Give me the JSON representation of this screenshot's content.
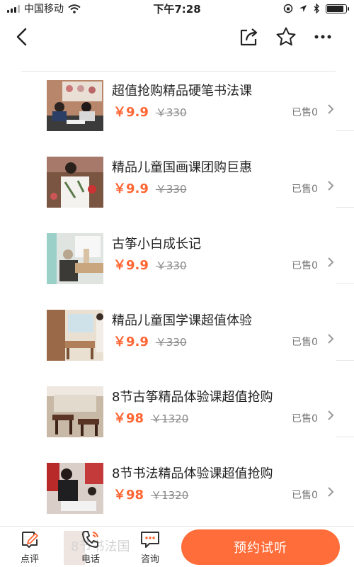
{
  "status_bar": {
    "carrier": "中国移动",
    "time": "下午7:28",
    "battery_level": 0.9
  },
  "items": [
    {
      "title": "超值抢购精品硬笔书法课",
      "price": "￥9.9",
      "original_price": "￥330",
      "sold": "已售0",
      "image": "calligraphy-class-photo"
    },
    {
      "title": "精品儿童国画课团购巨惠",
      "price": "￥9.9",
      "original_price": "￥330",
      "sold": "已售0",
      "image": "painting-class-photo"
    },
    {
      "title": "古筝小白成长记",
      "price": "￥9.9",
      "original_price": "￥330",
      "sold": "已售0",
      "image": "guzheng-class-photo"
    },
    {
      "title": "精品儿童国学课超值体验",
      "price": "￥9.9",
      "original_price": "￥330",
      "sold": "已售0",
      "image": "classroom-photo"
    },
    {
      "title": "8节古筝精品体验课超值抢购",
      "price": "￥98",
      "original_price": "￥1320",
      "sold": "已售0",
      "image": "guzheng-room-photo"
    },
    {
      "title": "8节书法精品体验课超值抢购",
      "price": "￥98",
      "original_price": "￥1320",
      "sold": "已售0",
      "image": "calligraphy-teacher-photo"
    }
  ],
  "bottom_bar": {
    "review_label": "点评",
    "phone_label": "电话",
    "consult_label": "咨询",
    "book_label": "预约试听",
    "partial_text": "8节书法国"
  },
  "colors": {
    "accent": "#ff6633",
    "button": "#ff6e3a"
  }
}
